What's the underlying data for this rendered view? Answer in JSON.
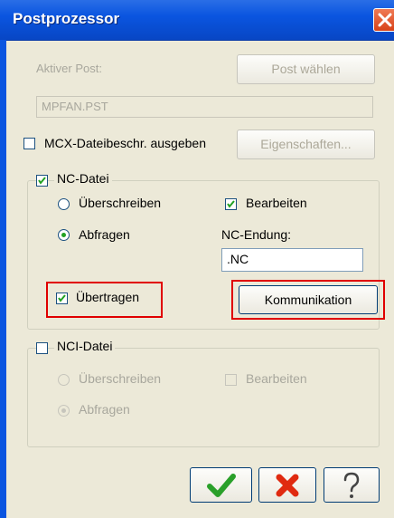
{
  "window": {
    "title": "Postprozessor"
  },
  "post": {
    "active_label": "Aktiver Post:",
    "choose_button": "Post wählen",
    "file_value": "MPFAN.PST"
  },
  "mcx": {
    "checkbox_label": "MCX-Dateibeschr. ausgeben",
    "properties_button": "Eigenschaften..."
  },
  "nc": {
    "group_label": "NC-Datei",
    "overwrite_label": "Überschreiben",
    "ask_label": "Abfragen",
    "edit_label": "Bearbeiten",
    "ext_label": "NC-Endung:",
    "ext_value": ".NC",
    "transfer_label": "Übertragen",
    "comm_button": "Kommunikation"
  },
  "nci": {
    "group_label": "NCI-Datei",
    "overwrite_label": "Überschreiben",
    "edit_label": "Bearbeiten",
    "ask_label": "Abfragen"
  },
  "buttons": {
    "ok_icon": "checkmark-icon",
    "cancel_icon": "x-icon",
    "help_icon": "question-icon"
  },
  "colors": {
    "title_bar": "#0a55e0",
    "dialog_bg": "#ece9d8",
    "highlight": "#e00000"
  }
}
